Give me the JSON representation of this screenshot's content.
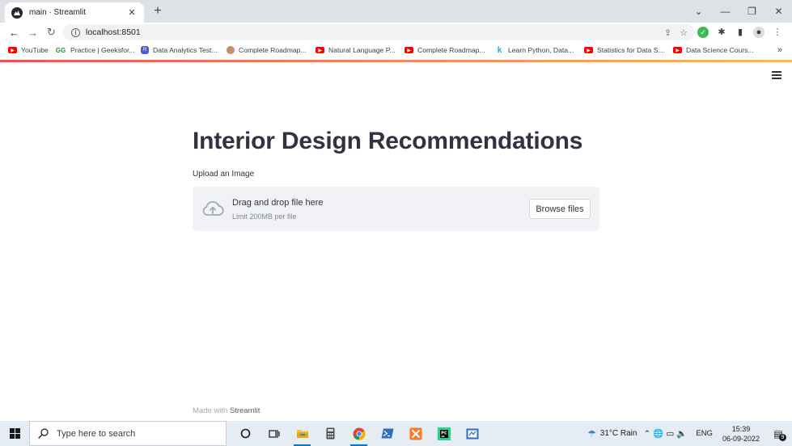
{
  "browser": {
    "tab_title": "main · Streamlit",
    "tab_close": "✕",
    "new_tab": "+",
    "url": "localhost:8501",
    "window_controls": [
      "⌄",
      "—",
      "❐",
      "✕"
    ],
    "bookmarks": [
      {
        "icon": "youtube-icon",
        "label": "YouTube"
      },
      {
        "icon": "geeksforgeeks-icon",
        "label": "Practice | Geeksfor..."
      },
      {
        "icon": "r-icon",
        "label": "Data Analytics Test..."
      },
      {
        "icon": "avatar-icon",
        "label": "Complete Roadmap..."
      },
      {
        "icon": "youtube-icon",
        "label": "Natural Language P..."
      },
      {
        "icon": "youtube-icon",
        "label": "Complete Roadmap..."
      },
      {
        "icon": "k-icon",
        "label": "Learn Python, Data..."
      },
      {
        "icon": "youtube-icon",
        "label": "Statistics for Data S..."
      },
      {
        "icon": "youtube-icon",
        "label": "Data Science Cours..."
      }
    ],
    "bookmarks_more": "»"
  },
  "app": {
    "title": "Interior Design Recommendations",
    "upload_label": "Upload an Image",
    "dropzone_main": "Drag and drop file here",
    "dropzone_limit": "Limit 200MB per file",
    "browse_button": "Browse files",
    "footer_prefix": "Made with",
    "footer_brand": "Streamlit"
  },
  "taskbar": {
    "search_placeholder": "Type here to search",
    "weather": "31°C  Rain",
    "language": "ENG",
    "time": "15:39",
    "date": "06-09-2022",
    "notification_count": "9"
  },
  "colors": {
    "accent_gradient_start": "#ff4b4b",
    "accent_gradient_end": "#ffbd45",
    "title_text": "#31333f",
    "dropzone_bg": "#f0f2f6"
  }
}
